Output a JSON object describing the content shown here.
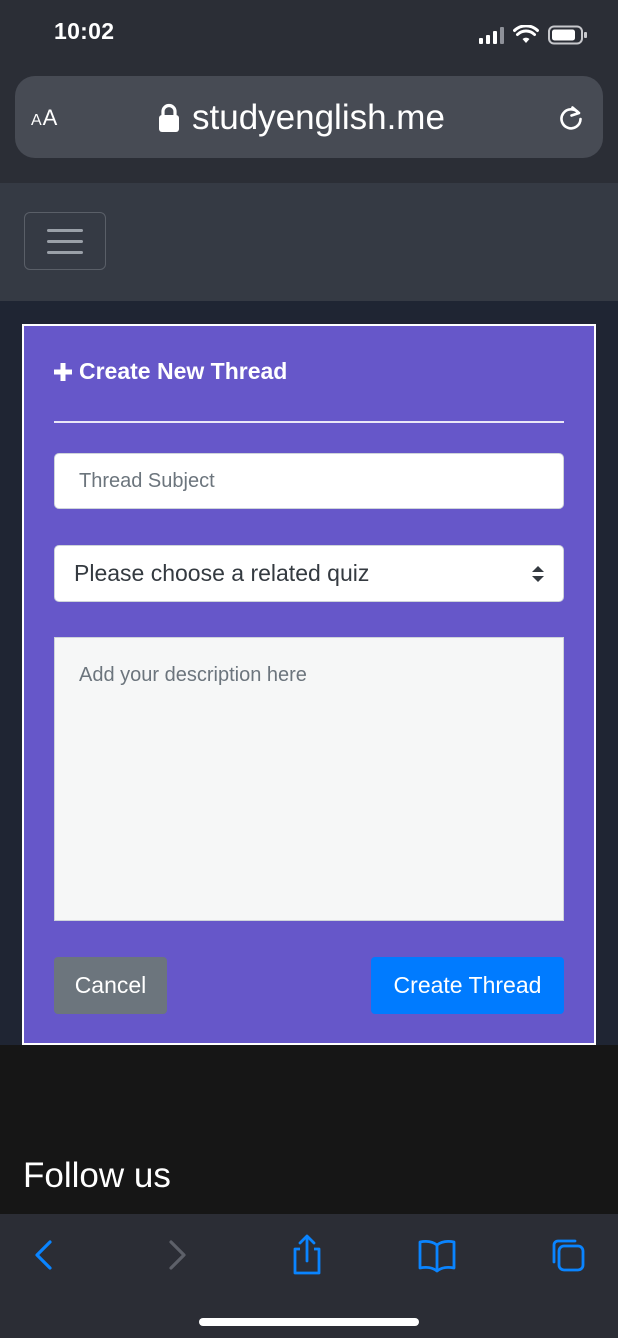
{
  "status_bar": {
    "time": "10:02"
  },
  "browser": {
    "text_size_label": "AA",
    "url": "studyenglish.me"
  },
  "form": {
    "title": "Create New Thread",
    "subject_placeholder": "Thread Subject",
    "quiz_select_value": "Please choose a related quiz",
    "description_placeholder": "Add your description here",
    "cancel_label": "Cancel",
    "submit_label": "Create Thread"
  },
  "footer": {
    "follow_label": "Follow us"
  },
  "colors": {
    "card_background": "#6657c9",
    "primary_button": "#007bff",
    "secondary_button": "#6c757d",
    "safari_accent": "#0a84ff"
  },
  "toolbar_icons": [
    "back-icon",
    "forward-icon",
    "share-icon",
    "bookmarks-icon",
    "tabs-icon"
  ]
}
